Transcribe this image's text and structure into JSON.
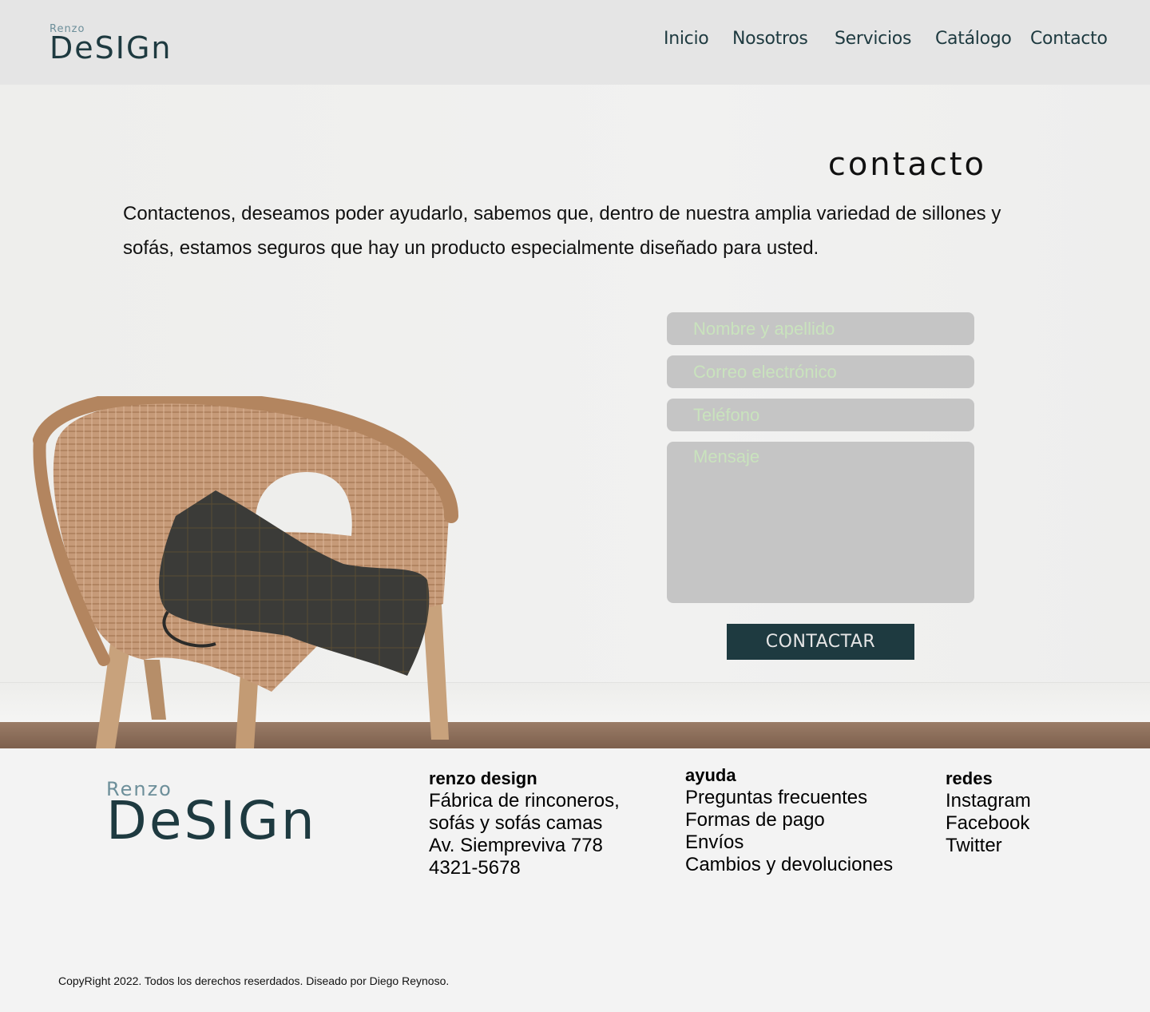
{
  "header": {
    "logo": {
      "renzo": "Renzo",
      "design": "DeSIGn"
    },
    "nav": [
      {
        "label": "Inicio"
      },
      {
        "label": "Nosotros"
      },
      {
        "label": "Servicios"
      },
      {
        "label": "Catálogo"
      },
      {
        "label": "Contacto"
      }
    ]
  },
  "hero": {
    "title": "contacto",
    "intro": "Contactenos, deseamos poder ayudarlo, sabemos que, dentro de nuestra amplia variedad de sillones y sofás, estamos seguros que hay un producto especialmente diseñado para usted."
  },
  "form": {
    "name_placeholder": "Nombre y apellido",
    "email_placeholder": "Correo electrónico",
    "phone_placeholder": "Teléfono",
    "message_placeholder": "Mensaje",
    "submit_label": "CONTACTAR"
  },
  "footer": {
    "logo": {
      "renzo": "Renzo",
      "design": "DeSIGn"
    },
    "company": {
      "heading": "renzo design",
      "lines": [
        "Fábrica de rinconeros,",
        "sofás y sofás camas",
        "Av. Siempreviva 778",
        "4321-5678"
      ]
    },
    "help": {
      "heading": "ayuda",
      "links": [
        "Preguntas frecuentes",
        "Formas de pago",
        "Envíos",
        "Cambios y devoluciones"
      ]
    },
    "social": {
      "heading": "redes",
      "links": [
        "Instagram",
        "Facebook",
        "Twitter"
      ]
    },
    "copyright": "CopyRight 2022. Todos los derechos reserdados. Diseado por Diego Reynoso."
  },
  "colors": {
    "brand": "#1e3a40",
    "header_bg": "#e5e5e5",
    "field_bg": "#c5c5c5",
    "placeholder": "#c9e3bd"
  }
}
